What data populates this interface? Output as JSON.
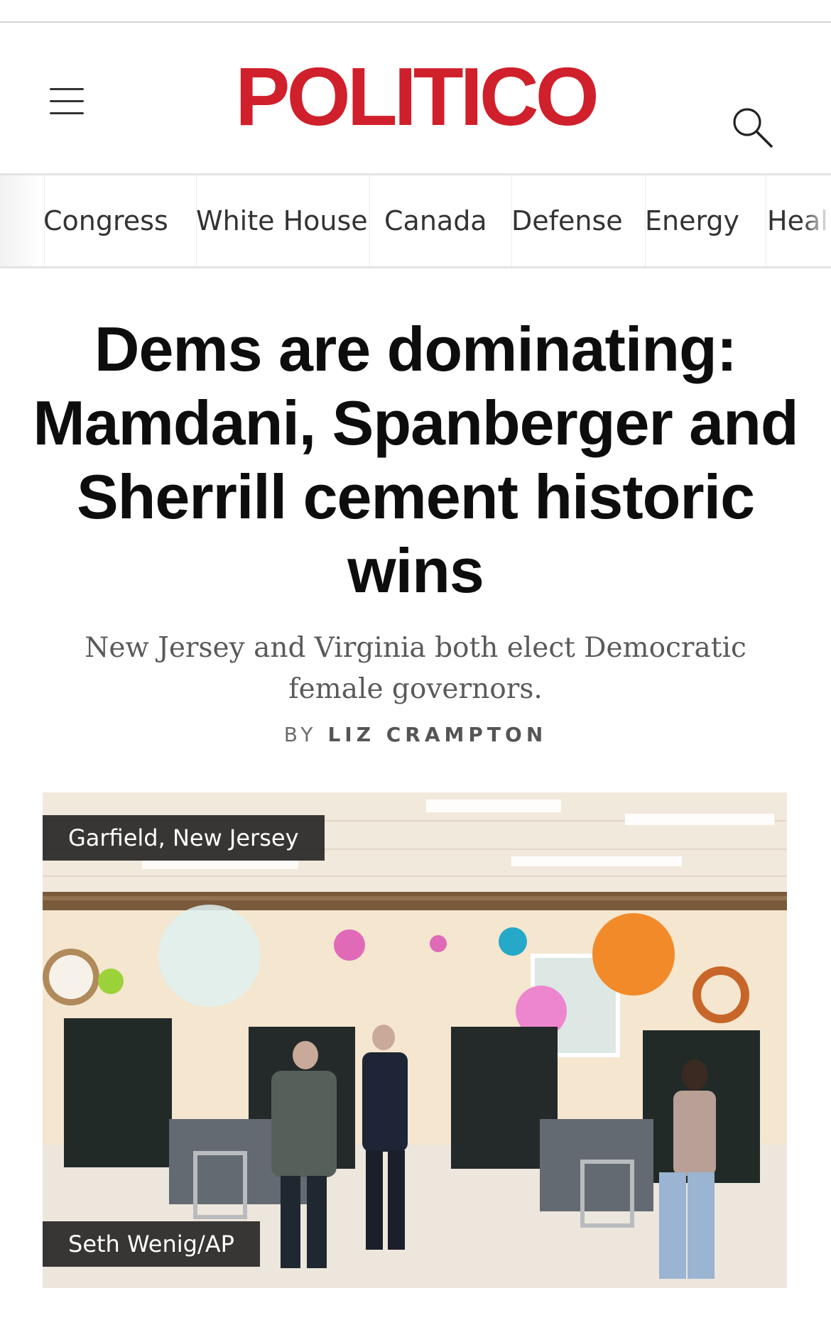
{
  "masthead": {
    "logo": "POLITICO",
    "menu_icon": "hamburger-menu-icon",
    "search_icon": "search-icon",
    "brand_color": "#d0202b"
  },
  "nav": {
    "items": [
      "Congress",
      "White House",
      "Canada",
      "Defense",
      "Energy",
      "Heal"
    ]
  },
  "article": {
    "headline": "Dems are dominating: Mamdani, Spanberger and Sherrill cement historic wins",
    "dek": "New Jersey and Virginia both elect Democratic female governors.",
    "byline_prefix": "BY",
    "byline_author": "LIZ CRAMPTON"
  },
  "photo": {
    "location": "Garfield, New Jersey",
    "credit": "Seth Wenig/AP"
  }
}
